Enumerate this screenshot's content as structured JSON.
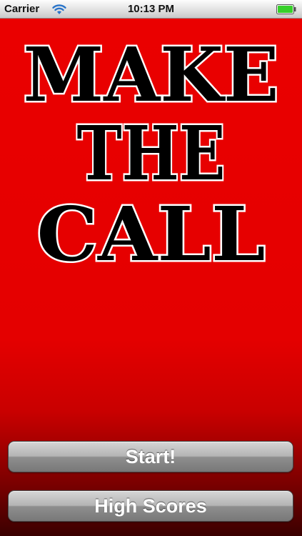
{
  "status_bar": {
    "carrier": "Carrier",
    "time": "10:13 PM",
    "wifi_icon": "wifi-icon",
    "battery_icon": "battery-icon",
    "battery_color": "#37d02a"
  },
  "title": {
    "line1": "MAKE",
    "line2": "THE",
    "line3": "CALL"
  },
  "buttons": {
    "start_label": "Start!",
    "high_scores_label": "High Scores"
  },
  "colors": {
    "background": "#e60000",
    "title_fill": "#000000",
    "title_outline": "#ffffff",
    "button_text": "#ffffff"
  }
}
